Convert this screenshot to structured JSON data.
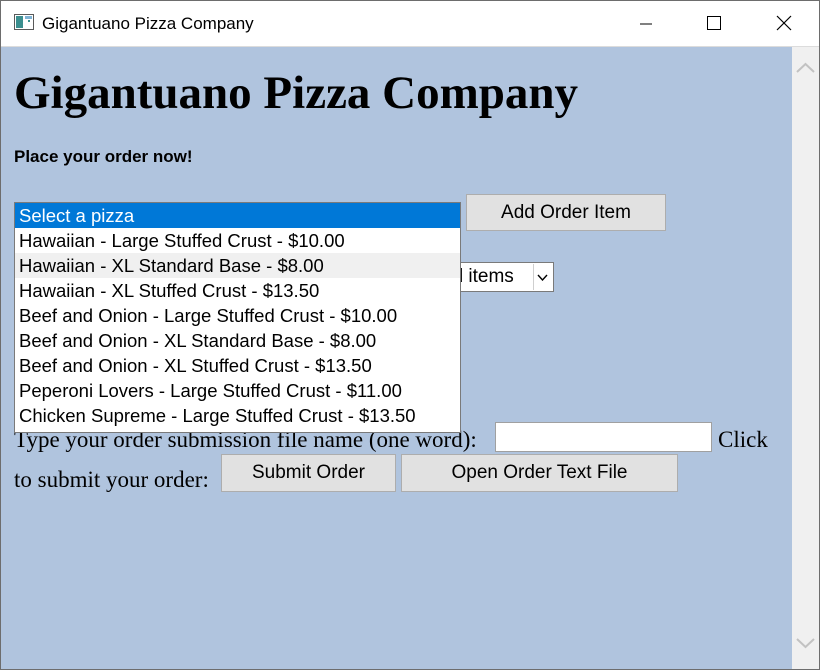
{
  "window": {
    "title": "Gigantuano Pizza Company",
    "controls": [
      "minimize-icon",
      "maximize-icon",
      "close-icon"
    ]
  },
  "colors": {
    "page_background": "#b0c4de",
    "selection": "#0078d7",
    "hover": "#f0f0f0"
  },
  "page": {
    "heading": "Gigantuano Pizza Company",
    "subtitle": "Place your order now!"
  },
  "order": {
    "pizza_options": [
      "Select a pizza",
      "Hawaiian - Large Stuffed Crust - $10.00",
      "Hawaiian - XL Standard Base - $8.00",
      "Hawaiian - XL Stuffed Crust - $13.50",
      "Beef and Onion - Large Stuffed Crust - $10.00",
      "Beef and Onion - XL Standard Base - $8.00",
      "Beef and Onion - XL Stuffed Crust - $13.50",
      "Peperoni Lovers - Large Stuffed Crust - $11.00",
      "Chicken Supreme - Large Stuffed Crust - $13.50"
    ],
    "selected_option": "Select a pizza",
    "hovered_option": "Hawaiian - XL Standard Base - $8.00",
    "add_button": "Add Order Item",
    "saved_items_select_visible": "ed items"
  },
  "submission": {
    "filename_label": "Type your order submission file name (one word):",
    "filename_value": "",
    "click_label": "Click",
    "submit_label": "to submit your order:",
    "submit_button": "Submit Order",
    "open_button": "Open Order Text File"
  }
}
